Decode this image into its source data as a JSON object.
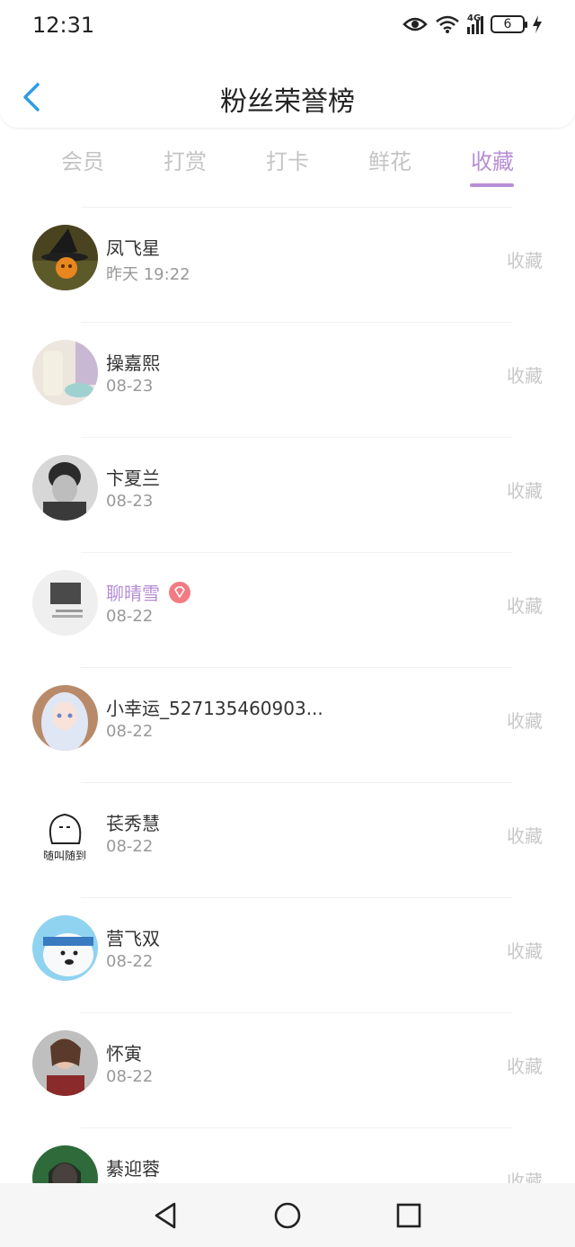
{
  "status": {
    "time": "12:31",
    "network": "4G",
    "battery": "6"
  },
  "header": {
    "title": "粉丝荣誉榜"
  },
  "tabs": [
    {
      "label": "会员"
    },
    {
      "label": "打赏"
    },
    {
      "label": "打卡"
    },
    {
      "label": "鲜花"
    },
    {
      "label": "收藏",
      "active": true
    }
  ],
  "fans": [
    {
      "name": "凤飞星",
      "date": "昨天 19:22",
      "action": "收藏"
    },
    {
      "name": "操嘉熙",
      "date": "08-23",
      "action": "收藏"
    },
    {
      "name": "卞夏兰",
      "date": "08-23",
      "action": "收藏"
    },
    {
      "name": "聊晴雪",
      "date": "08-22",
      "action": "收藏",
      "vip": true
    },
    {
      "name": "小幸运_527135460903...",
      "date": "08-22",
      "action": "收藏"
    },
    {
      "name": "苌秀慧",
      "date": "08-22",
      "action": "收藏"
    },
    {
      "name": "营飞双",
      "date": "08-22",
      "action": "收藏"
    },
    {
      "name": "怀寅",
      "date": "08-22",
      "action": "收藏"
    },
    {
      "name": "綦迎蓉",
      "date": "",
      "action": "收藏"
    }
  ],
  "colors": {
    "accent": "#b78ed6",
    "back": "#2d9ce6",
    "vip_badge": "#f27b83"
  }
}
